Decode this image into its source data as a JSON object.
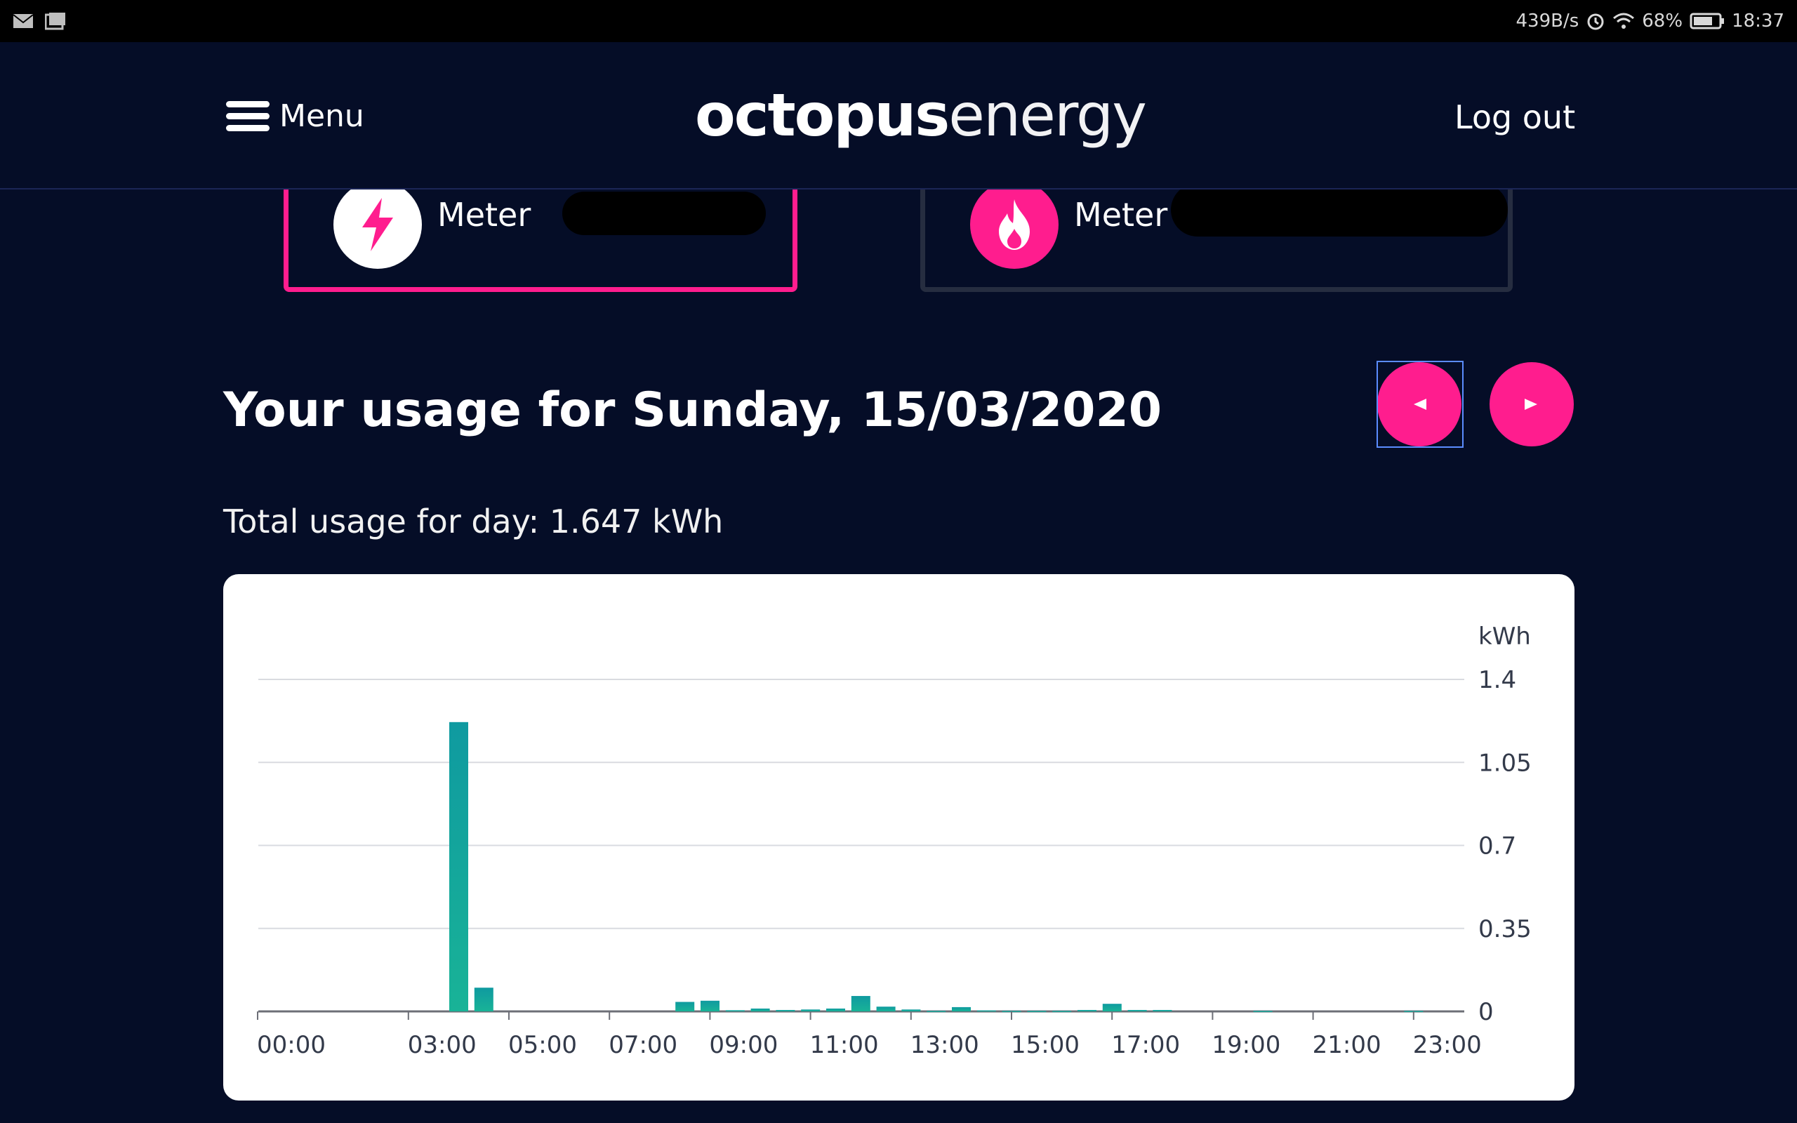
{
  "status_bar": {
    "network_speed": "439B/s",
    "battery": "68%",
    "time": "18:37",
    "icons": [
      "mail-icon",
      "gallery-icon",
      "alarm-icon",
      "wifi-icon",
      "battery-icon"
    ]
  },
  "header": {
    "menu_label": "Menu",
    "logo_bold": "octopus",
    "logo_light": "energy",
    "logout_label": "Log out"
  },
  "meters": [
    {
      "label": "Meter",
      "icon": "lightning-icon",
      "selected": true
    },
    {
      "label": "Meter",
      "icon": "flame-icon",
      "selected": false
    }
  ],
  "usage": {
    "title": "Your usage for Sunday, 15/03/2020",
    "total": "Total usage for day: 1.647 kWh"
  },
  "colors": {
    "background": "#050d27",
    "accent": "#ff1d8e",
    "bar": "#16a79a"
  },
  "chart_data": {
    "type": "bar",
    "ylabel": "kWh",
    "ylim": [
      0,
      1.4
    ],
    "yticks": [
      "1.4",
      "1.05",
      "0.7",
      "0.35",
      "0"
    ],
    "xticks": [
      "00:00",
      "03:00",
      "05:00",
      "07:00",
      "09:00",
      "11:00",
      "13:00",
      "15:00",
      "17:00",
      "19:00",
      "21:00",
      "23:00"
    ],
    "interval": "30 min",
    "values": [
      0,
      0,
      0,
      0,
      0,
      0,
      0,
      1.22,
      0.1,
      0,
      0,
      0,
      0,
      0,
      0,
      0,
      0.04,
      0.045,
      0.005,
      0.012,
      0.006,
      0.008,
      0.012,
      0.065,
      0.02,
      0.008,
      0.002,
      0.018,
      0.004,
      0.002,
      0.002,
      0.002,
      0.006,
      0.032,
      0.006,
      0.006,
      0,
      0,
      0,
      0.002,
      0,
      0,
      0,
      0,
      0,
      0.002,
      0,
      0
    ]
  }
}
